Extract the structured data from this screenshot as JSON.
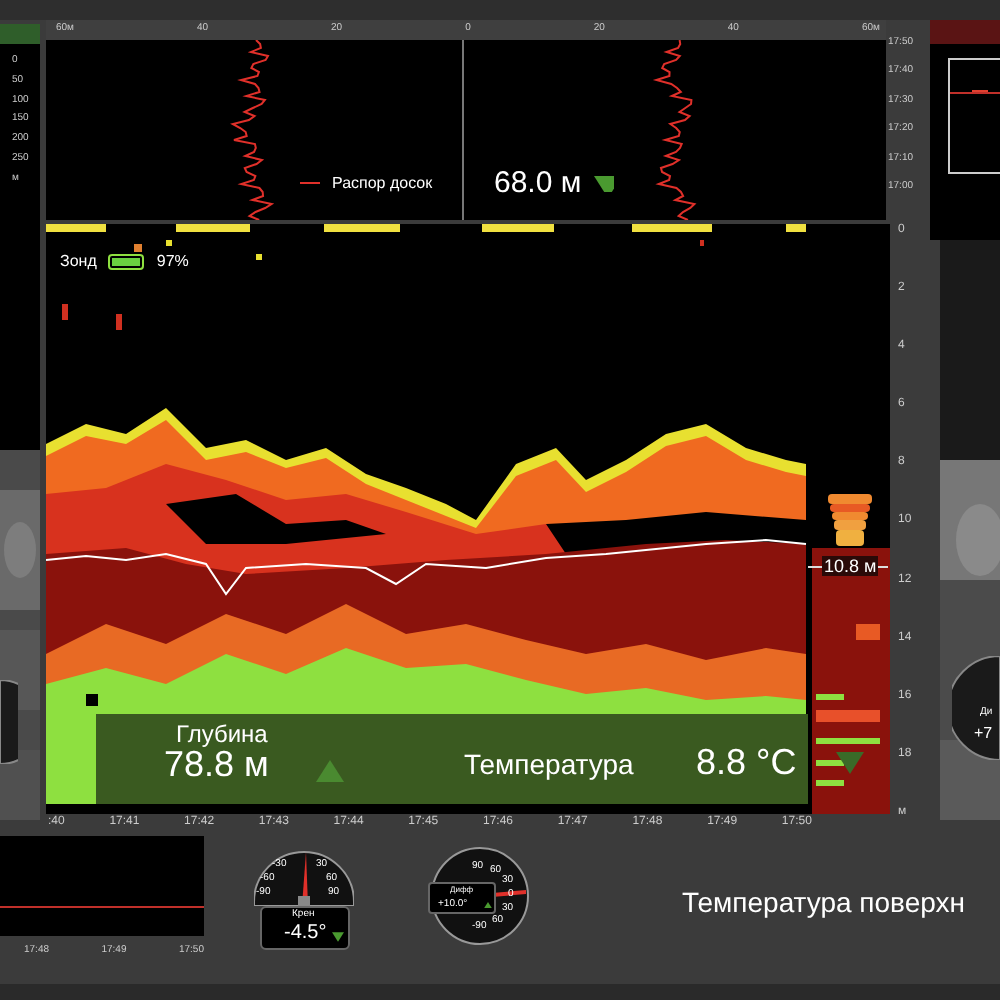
{
  "left_panel": {
    "scale": [
      "0",
      "50",
      "100",
      "150",
      "200",
      "250",
      "м"
    ]
  },
  "spread_panel": {
    "scale": [
      "60м",
      "40",
      "20",
      "0",
      "20",
      "40",
      "60м"
    ],
    "time_axis": [
      "17:50",
      "17:40",
      "17:30",
      "17:20",
      "17:10",
      "17:00"
    ],
    "legend": "Распор досок",
    "reading": "68.0 м",
    "rising": false
  },
  "echogram": {
    "probe": {
      "label": "Зонд",
      "level": 0.97,
      "percent": "97%"
    },
    "depth_marker": "10.8 м",
    "depth_scale": [
      "0",
      "2",
      "4",
      "6",
      "8",
      "10",
      "12",
      "14",
      "16",
      "18",
      "м"
    ],
    "time_axis": [
      ":40",
      "17:41",
      "17:42",
      "17:43",
      "17:44",
      "17:45",
      "17:46",
      "17:47",
      "17:48",
      "17:49",
      "17:50"
    ],
    "depth": {
      "label": "Глубина",
      "value": "78.8 м",
      "rising": true
    },
    "temperature": {
      "label": "Температура",
      "value": "8.8 °C",
      "rising": false
    }
  },
  "bottom_chart": {
    "time_axis": [
      "17:48",
      "17:49",
      "17:50"
    ]
  },
  "roll_gauge": {
    "label": "Крен",
    "value": "-4.5°",
    "ticks": [
      "-30",
      "30",
      "-60",
      "60",
      "-90",
      "90"
    ],
    "rising": false
  },
  "trim_gauge": {
    "label": "Дифф",
    "value": "+10.0°",
    "ticks": [
      "90",
      "60",
      "30",
      "0",
      "30",
      "60",
      "-90"
    ],
    "rising": true
  },
  "right_gauge": {
    "label": "Ди",
    "value": "+7"
  },
  "surface_temperature": {
    "label": "Температура поверхн"
  }
}
